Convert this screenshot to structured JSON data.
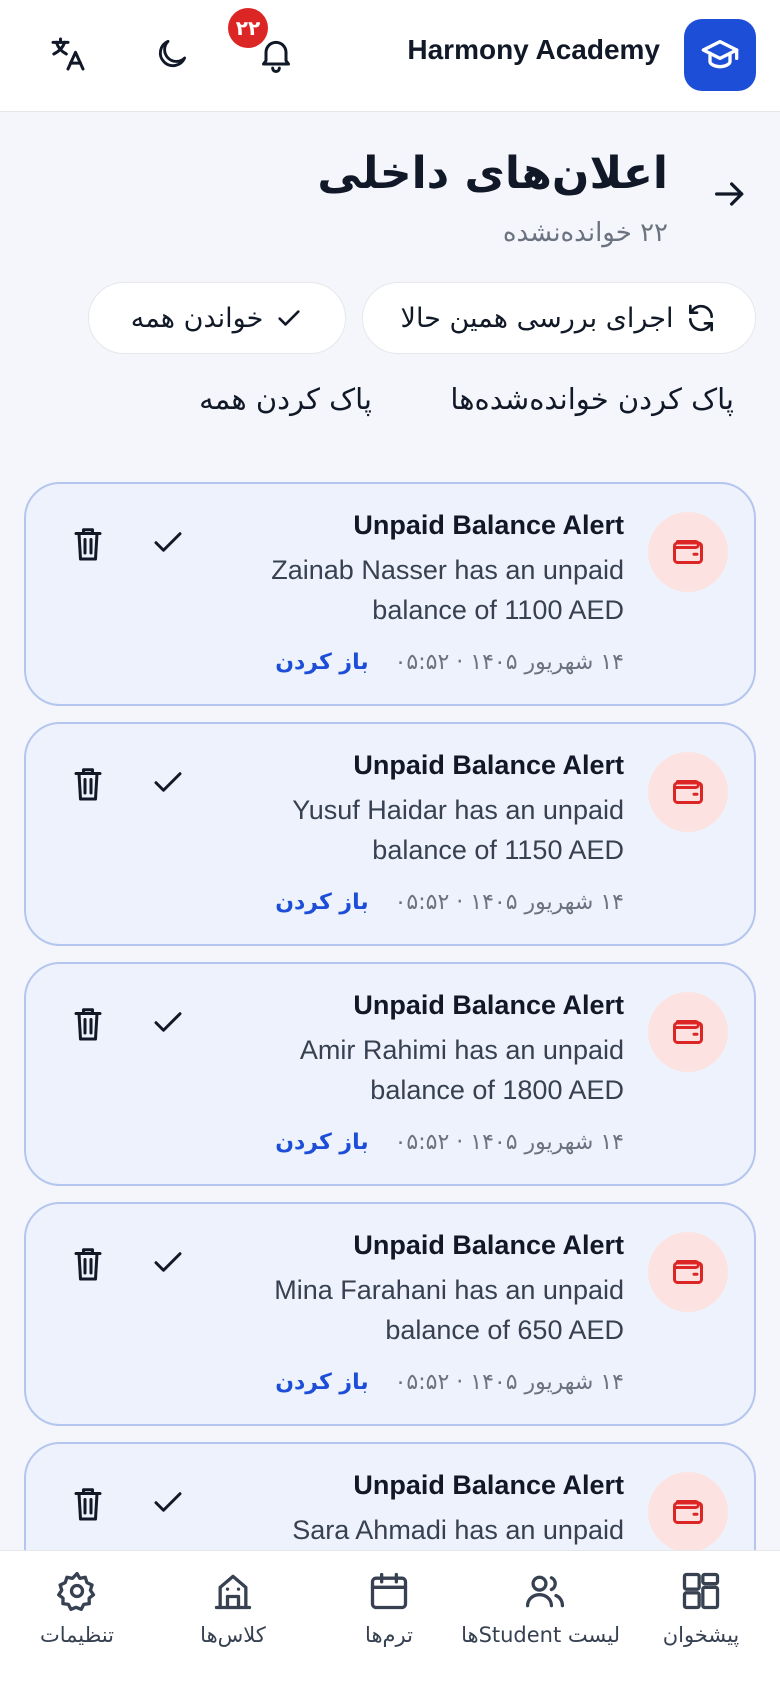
{
  "header": {
    "brand": "Harmony Academy",
    "notification_count": "۲۲"
  },
  "page": {
    "title": "اعلان‌های داخلی",
    "unread": "۲۲ خوانده‌نشده"
  },
  "actions": {
    "run_check": "اجرای بررسی همین حالا",
    "read_all": "خواندن همه",
    "clear_read": "پاک کردن خوانده‌شده‌ها",
    "clear_all": "پاک کردن همه"
  },
  "notifications": [
    {
      "title": "Unpaid Balance Alert",
      "message": "Zainab Nasser has an unpaid balance of 1100 AED",
      "time": "۱۴ شهریور ۱۴۰۵ · ۰۵:۵۲",
      "open": "باز کردن"
    },
    {
      "title": "Unpaid Balance Alert",
      "message": "Yusuf Haidar has an unpaid balance of 1150 AED",
      "time": "۱۴ شهریور ۱۴۰۵ · ۰۵:۵۲",
      "open": "باز کردن"
    },
    {
      "title": "Unpaid Balance Alert",
      "message": "Amir Rahimi has an unpaid balance of 1800 AED",
      "time": "۱۴ شهریور ۱۴۰۵ · ۰۵:۵۲",
      "open": "باز کردن"
    },
    {
      "title": "Unpaid Balance Alert",
      "message": "Mina Farahani has an unpaid balance of 650 AED",
      "time": "۱۴ شهریور ۱۴۰۵ · ۰۵:۵۲",
      "open": "باز کردن"
    },
    {
      "title": "Unpaid Balance Alert",
      "message": "Sara Ahmadi has an unpaid",
      "time": "",
      "open": ""
    }
  ],
  "bottom_nav": [
    {
      "label": "پیشخوان",
      "icon": "dashboard-icon"
    },
    {
      "label": "لیست Studentها",
      "icon": "users-icon"
    },
    {
      "label": "ترم‌ها",
      "icon": "calendar-icon"
    },
    {
      "label": "کلاس‌ها",
      "icon": "building-icon"
    },
    {
      "label": "تنظیمات",
      "icon": "gear-icon"
    }
  ],
  "colors": {
    "primary": "#1d4ed8",
    "badge": "#dc2626",
    "card_bg": "#eef2fc",
    "card_border": "#b4c6ef",
    "alert_icon_bg": "#fde2e2",
    "alert_icon": "#dc2626"
  }
}
